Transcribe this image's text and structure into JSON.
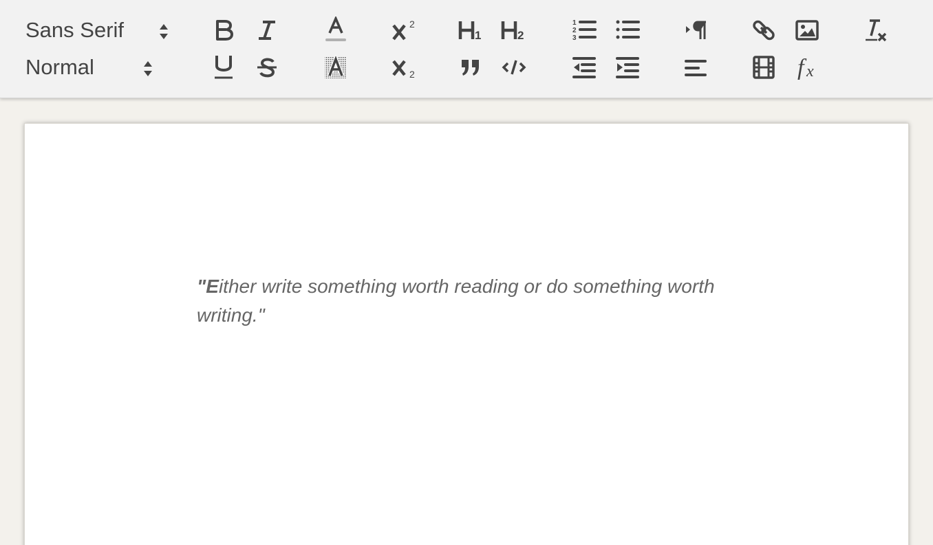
{
  "toolbar": {
    "font_picker": {
      "value": "Sans Serif"
    },
    "size_picker": {
      "value": "Normal"
    },
    "buttons": [
      "bold-icon",
      "italic-icon",
      "underline-icon",
      "strike-icon",
      "font-color-icon",
      "background-color-icon",
      "superscript-icon",
      "subscript-icon",
      "header-1-icon",
      "header-2-icon",
      "blockquote-icon",
      "code-block-icon",
      "ordered-list-icon",
      "bullet-list-icon",
      "outdent-icon",
      "indent-icon",
      "text-direction-icon",
      "align-icon",
      "link-icon",
      "image-icon",
      "video-icon",
      "formula-icon",
      "clean-icon"
    ]
  },
  "editor": {
    "quote_first": "\"E",
    "quote_rest": "ither write something worth reading or do something worth writing.\""
  },
  "colors": {
    "icon": "#444444",
    "toolbar_bg": "#f2f2f2",
    "page_bg": "#f3f1ec",
    "text": "#666666"
  }
}
